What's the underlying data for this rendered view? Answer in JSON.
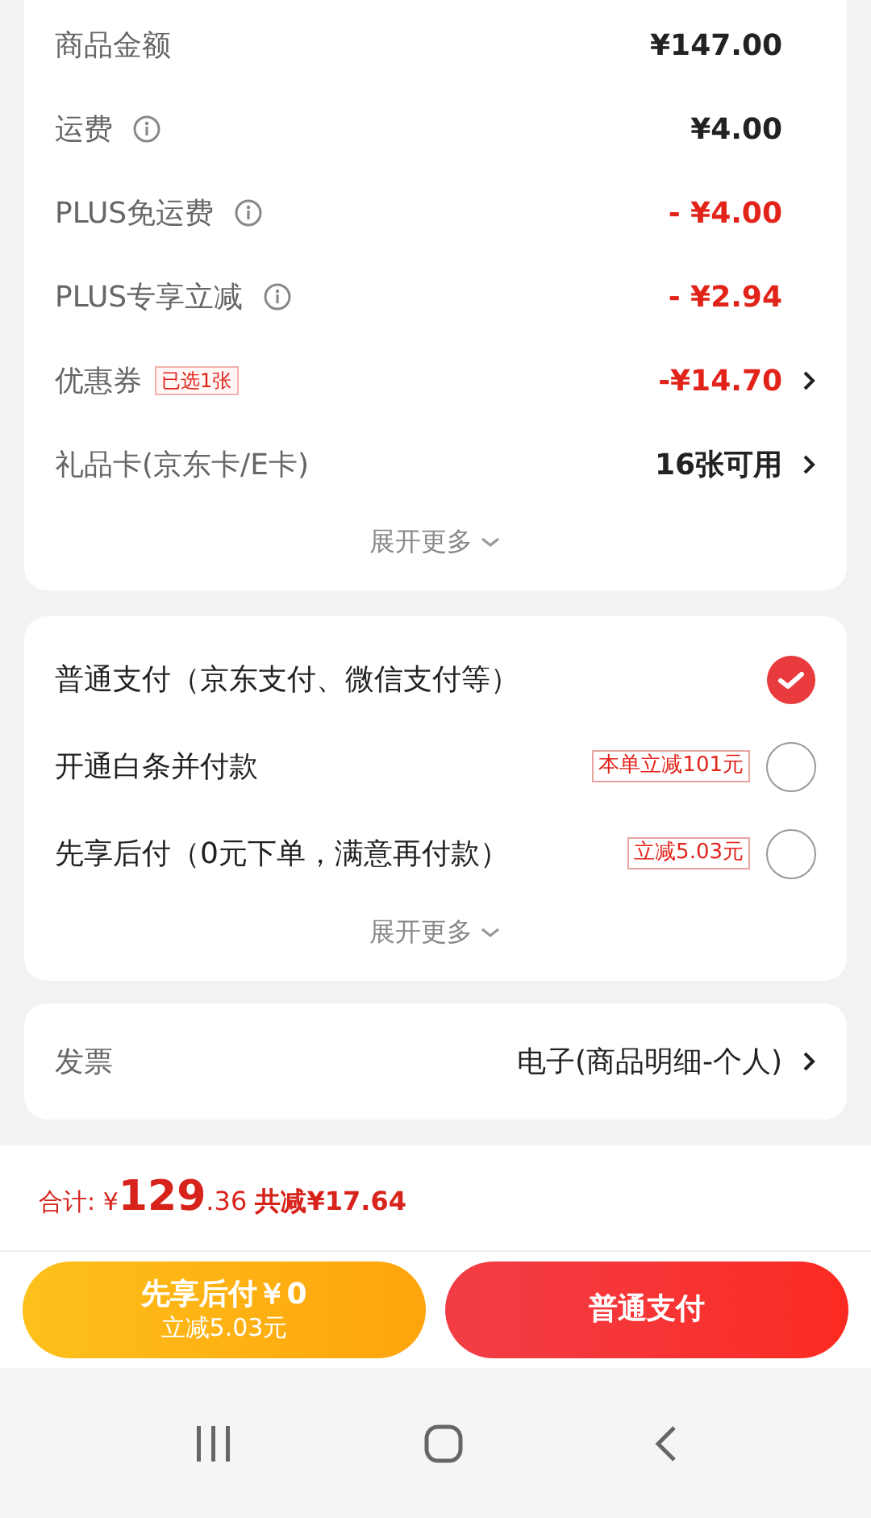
{
  "fees": [
    {
      "label": "商品金额",
      "info": false,
      "value": "¥147.00",
      "red": false,
      "arrow": false
    },
    {
      "label": "运费",
      "info": true,
      "value": "¥4.00",
      "red": false,
      "arrow": false
    },
    {
      "label": "PLUS免运费",
      "info": true,
      "value": "- ¥4.00",
      "red": true,
      "arrow": false
    },
    {
      "label": "PLUS专享立减",
      "info": true,
      "value": "- ¥2.94",
      "red": true,
      "arrow": false
    },
    {
      "label": "优惠券",
      "info": false,
      "tag": "已选1张",
      "value": "-¥14.70",
      "red": true,
      "arrow": true
    },
    {
      "label": "礼品卡(京东卡/E卡)",
      "info": false,
      "value": "16张可用",
      "red": false,
      "arrow": true
    }
  ],
  "fees_more": "展开更多",
  "payments": [
    {
      "label": "普通支付（京东支付、微信支付等）",
      "selected": true
    },
    {
      "label": "开通白条并付款",
      "tag": "本单立减101元",
      "selected": false
    },
    {
      "label": "先享后付（0元下单，满意再付款）",
      "tag": "立减5.03元",
      "selected": false
    }
  ],
  "payments_more": "展开更多",
  "invoice": {
    "label": "发票",
    "value": "电子(商品明细-个人)"
  },
  "total": {
    "label": "合计:",
    "currency": "¥",
    "integer": "129",
    "decimal": ".36",
    "saving": "共减¥17.64"
  },
  "buttons": [
    {
      "kind": "later",
      "title": "先享后付￥0",
      "subtitle": "立减5.03元"
    },
    {
      "kind": "pay",
      "title": "普通支付"
    }
  ]
}
